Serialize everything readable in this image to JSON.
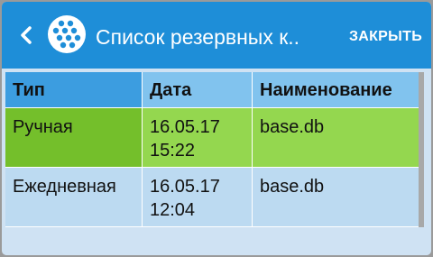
{
  "appbar": {
    "title": "Список резервных к..",
    "close_label": "ЗАКРЫТЬ"
  },
  "icons": {
    "back": "chevron-left-icon",
    "logo": "app-logo-icon"
  },
  "colors": {
    "appbar": "#1e8ed8",
    "header_row": "#81c3ee",
    "header_first_cell": "#3c9de0",
    "selected_row": "#94d74f",
    "selected_first_cell": "#74bf2b",
    "row": "#bcdaf1"
  },
  "table": {
    "columns": [
      "Тип",
      "Дата",
      "Наименование"
    ],
    "rows": [
      {
        "type": "Ручная",
        "date": "16.05.17",
        "time": "15:22",
        "name": "base.db",
        "selected": true
      },
      {
        "type": "Ежедневная",
        "date": "16.05.17",
        "time": "12:04",
        "name": "base.db",
        "selected": false
      }
    ]
  }
}
